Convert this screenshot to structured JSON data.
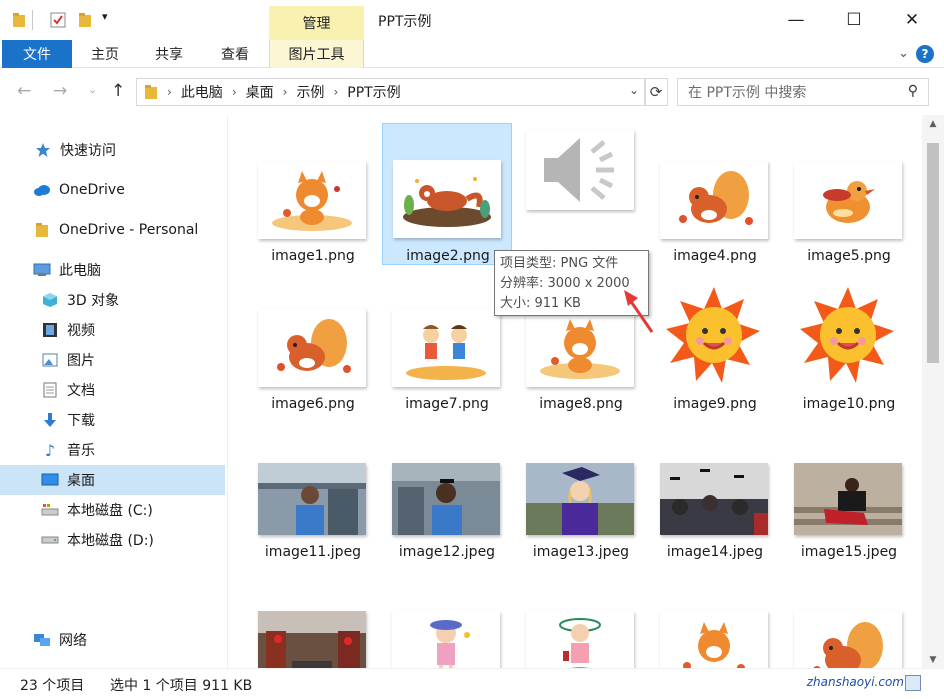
{
  "window": {
    "title": "PPT示例",
    "context_tab_group": "管理",
    "minimize": "—",
    "maximize": "☐",
    "close": "✕"
  },
  "ribbon": {
    "tabs": [
      "文件",
      "主页",
      "共享",
      "查看",
      "图片工具"
    ],
    "active_tab": "文件",
    "accent_color": "#1a73c9",
    "context_color": "#f8f1b0"
  },
  "address": {
    "path": [
      "此电脑",
      "桌面",
      "示例",
      "PPT示例"
    ],
    "search_placeholder": "在 PPT示例 中搜索"
  },
  "sidebar": {
    "items": [
      {
        "label": "快速访问",
        "icon": "star-icon"
      },
      {
        "label": "OneDrive",
        "icon": "cloud-icon"
      },
      {
        "label": "OneDrive - Personal",
        "icon": "folder-icon"
      },
      {
        "label": "此电脑",
        "icon": "computer-icon"
      },
      {
        "label": "3D 对象",
        "icon": "cube-icon"
      },
      {
        "label": "视频",
        "icon": "film-icon"
      },
      {
        "label": "图片",
        "icon": "picture-icon"
      },
      {
        "label": "文档",
        "icon": "document-icon"
      },
      {
        "label": "下载",
        "icon": "download-icon"
      },
      {
        "label": "音乐",
        "icon": "music-icon"
      },
      {
        "label": "桌面",
        "icon": "desktop-icon",
        "selected": true
      },
      {
        "label": "本地磁盘 (C:)",
        "icon": "drive-c-icon"
      },
      {
        "label": "本地磁盘 (D:)",
        "icon": "drive-icon"
      },
      {
        "label": "网络",
        "icon": "network-icon"
      }
    ]
  },
  "files": [
    {
      "name": "image1.png",
      "thumb": "fox"
    },
    {
      "name": "image2.png",
      "thumb": "red-panda",
      "selected": true
    },
    {
      "name": "",
      "thumb": "speaker"
    },
    {
      "name": "image4.png",
      "thumb": "squirrel"
    },
    {
      "name": "image5.png",
      "thumb": "bird"
    },
    {
      "name": "image6.png",
      "thumb": "squirrel"
    },
    {
      "name": "image7.png",
      "thumb": "kids"
    },
    {
      "name": "image8.png",
      "thumb": "fox"
    },
    {
      "name": "image9.png",
      "thumb": "sun"
    },
    {
      "name": "image10.png",
      "thumb": "sun"
    },
    {
      "name": "image11.jpeg",
      "thumb": "photo-grad"
    },
    {
      "name": "image12.jpeg",
      "thumb": "photo-grad"
    },
    {
      "name": "image13.jpeg",
      "thumb": "photo-grad-purple"
    },
    {
      "name": "image14.jpeg",
      "thumb": "photo-caps"
    },
    {
      "name": "image15.jpeg",
      "thumb": "photo-steps"
    },
    {
      "name": "",
      "thumb": "photo-street"
    },
    {
      "name": "",
      "thumb": "girl"
    },
    {
      "name": "",
      "thumb": "girl-hat"
    },
    {
      "name": "",
      "thumb": "fox"
    },
    {
      "name": "",
      "thumb": "squirrel"
    }
  ],
  "tooltip": {
    "line1": "项目类型: PNG 文件",
    "line2": "分辨率: 3000 x 2000",
    "line3": "大小: 911 KB"
  },
  "status": {
    "count": "23 个项目",
    "selection": "选中 1 个项目  911 KB",
    "watermark": "zhanshaoyi.com"
  }
}
